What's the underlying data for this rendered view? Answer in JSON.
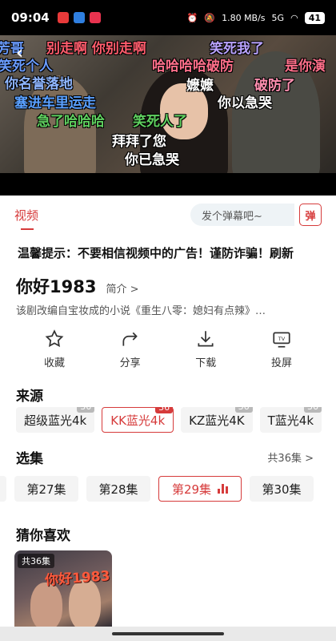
{
  "status_bar": {
    "time": "09:04",
    "net_speed": "1.80 MB/s",
    "signal": "5G",
    "battery": "41"
  },
  "danmaku": [
    {
      "text": "别走啊 你别走啊",
      "color": "#ff5c6c"
    },
    {
      "text": "笑死我了",
      "color": "#b9a3ff"
    },
    {
      "text": "笑死个人",
      "color": "#6a9cff"
    },
    {
      "text": "哈哈哈哈破防",
      "color": "#ff6f8a"
    },
    {
      "text": "是你演",
      "color": "#ff6f8a"
    },
    {
      "text": "你名誉落地",
      "color": "#8fb6ff"
    },
    {
      "text": "嬷嬷",
      "color": "#ffffff"
    },
    {
      "text": "破防了",
      "color": "#ff8fb0"
    },
    {
      "text": "塞进车里运走",
      "color": "#5aa0ff"
    },
    {
      "text": "你以急哭",
      "color": "#ffffff"
    },
    {
      "text": "急了哈哈哈",
      "color": "#5fd05f"
    },
    {
      "text": "笑死人了",
      "color": "#5fd05f"
    },
    {
      "text": "拜拜了您",
      "color": "#ffffff"
    },
    {
      "text": "你已急哭",
      "color": "#ffffff"
    },
    {
      "text": "芳哥",
      "color": "#6a9cff"
    }
  ],
  "tabs": {
    "video": "视频"
  },
  "danmaku_input": {
    "placeholder": "发个弹幕吧~",
    "button": "弹"
  },
  "notice": "温馨提示：不要相信视频中的广告！谨防诈骗！刷新",
  "show": {
    "title": "你好1983",
    "intro_link": "简介 >",
    "description": "该剧改编自宝妆成的小说《重生八零：媳妇有点辣》…"
  },
  "actions": [
    {
      "label": "收藏",
      "icon": "star-icon"
    },
    {
      "label": "分享",
      "icon": "share-icon"
    },
    {
      "label": "下载",
      "icon": "download-icon"
    },
    {
      "label": "投屏",
      "icon": "tv-cast-icon"
    }
  ],
  "sources": {
    "title": "来源",
    "items": [
      {
        "label": "超级蓝光4k",
        "count": "36",
        "active": false
      },
      {
        "label": "KK蓝光4k",
        "count": "36",
        "active": true
      },
      {
        "label": "KZ蓝光4K",
        "count": "36",
        "active": false
      },
      {
        "label": "T蓝光4k",
        "count": "36",
        "active": false
      }
    ]
  },
  "episodes": {
    "title": "选集",
    "total": "共36集 >",
    "items": [
      {
        "label": "",
        "state": "partial"
      },
      {
        "label": "第27集",
        "state": "normal"
      },
      {
        "label": "第28集",
        "state": "normal"
      },
      {
        "label": "第29集",
        "state": "active"
      },
      {
        "label": "第30集",
        "state": "normal"
      }
    ]
  },
  "recommend": {
    "title": "猜你喜欢",
    "items": [
      {
        "badge": "共36集",
        "logo": "你好1983"
      }
    ]
  },
  "colors": {
    "accent": "#d63b3b"
  }
}
